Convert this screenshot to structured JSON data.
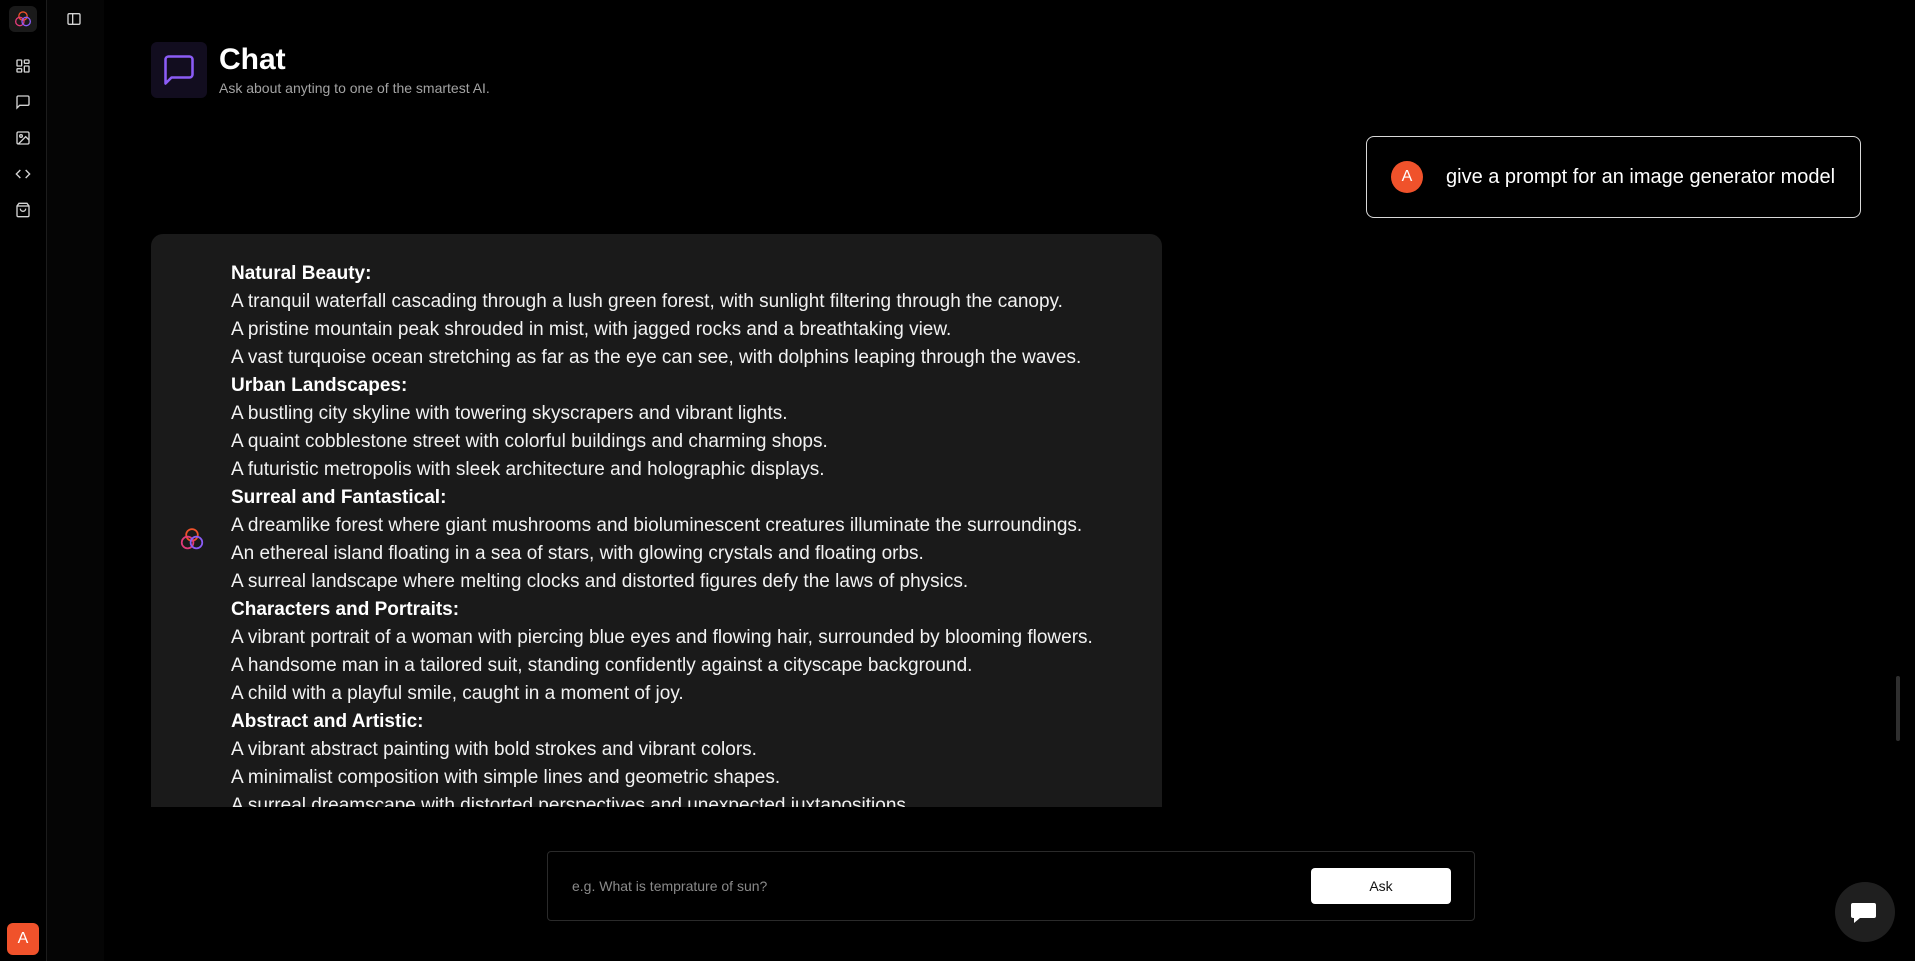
{
  "app": {
    "logo_icon": "trefoil-rings-logo",
    "brand_colors": {
      "ring_orange": "#f0522b",
      "ring_pink": "#e23b7a",
      "ring_purple": "#8b5cf6",
      "accent_purple": "#8b5cf6"
    }
  },
  "rail": {
    "items": [
      {
        "icon": "dashboard-grid-icon"
      },
      {
        "icon": "chat-bubble-icon"
      },
      {
        "icon": "image-icon"
      },
      {
        "icon": "code-icon"
      },
      {
        "icon": "shopping-bag-icon"
      }
    ],
    "user_initial": "A"
  },
  "header": {
    "icon": "chat-bubble-icon",
    "title": "Chat",
    "subtitle": "Ask about anyting to one of the smartest AI."
  },
  "conversation": {
    "user_message": {
      "avatar_initial": "A",
      "text": "give a prompt for an image generator model"
    },
    "ai_message": {
      "avatar_icon": "trefoil-rings-logo",
      "lines": [
        {
          "text": "Natural Beauty:",
          "heading": true
        },
        {
          "text": "A tranquil waterfall cascading through a lush green forest, with sunlight filtering through the canopy.",
          "heading": false
        },
        {
          "text": "A pristine mountain peak shrouded in mist, with jagged rocks and a breathtaking view.",
          "heading": false
        },
        {
          "text": "A vast turquoise ocean stretching as far as the eye can see, with dolphins leaping through the waves.",
          "heading": false
        },
        {
          "text": "Urban Landscapes:",
          "heading": true
        },
        {
          "text": "A bustling city skyline with towering skyscrapers and vibrant lights.",
          "heading": false
        },
        {
          "text": "A quaint cobblestone street with colorful buildings and charming shops.",
          "heading": false
        },
        {
          "text": "A futuristic metropolis with sleek architecture and holographic displays.",
          "heading": false
        },
        {
          "text": "Surreal and Fantastical:",
          "heading": true
        },
        {
          "text": "A dreamlike forest where giant mushrooms and bioluminescent creatures illuminate the surroundings.",
          "heading": false
        },
        {
          "text": "An ethereal island floating in a sea of stars, with glowing crystals and floating orbs.",
          "heading": false
        },
        {
          "text": "A surreal landscape where melting clocks and distorted figures defy the laws of physics.",
          "heading": false
        },
        {
          "text": "Characters and Portraits:",
          "heading": true
        },
        {
          "text": "A vibrant portrait of a woman with piercing blue eyes and flowing hair, surrounded by blooming flowers.",
          "heading": false
        },
        {
          "text": "A handsome man in a tailored suit, standing confidently against a cityscape background.",
          "heading": false
        },
        {
          "text": "A child with a playful smile, caught in a moment of joy.",
          "heading": false
        },
        {
          "text": "Abstract and Artistic:",
          "heading": true
        },
        {
          "text": "A vibrant abstract painting with bold strokes and vibrant colors.",
          "heading": false
        },
        {
          "text": "A minimalist composition with simple lines and geometric shapes.",
          "heading": false
        },
        {
          "text": "A surreal dreamscape with distorted perspectives and unexpected juxtapositions.",
          "heading": false
        }
      ]
    }
  },
  "composer": {
    "placeholder": "e.g. What is temprature of sun?",
    "value": "",
    "ask_label": "Ask"
  },
  "support_widget": {
    "icon": "chat-support-icon"
  }
}
